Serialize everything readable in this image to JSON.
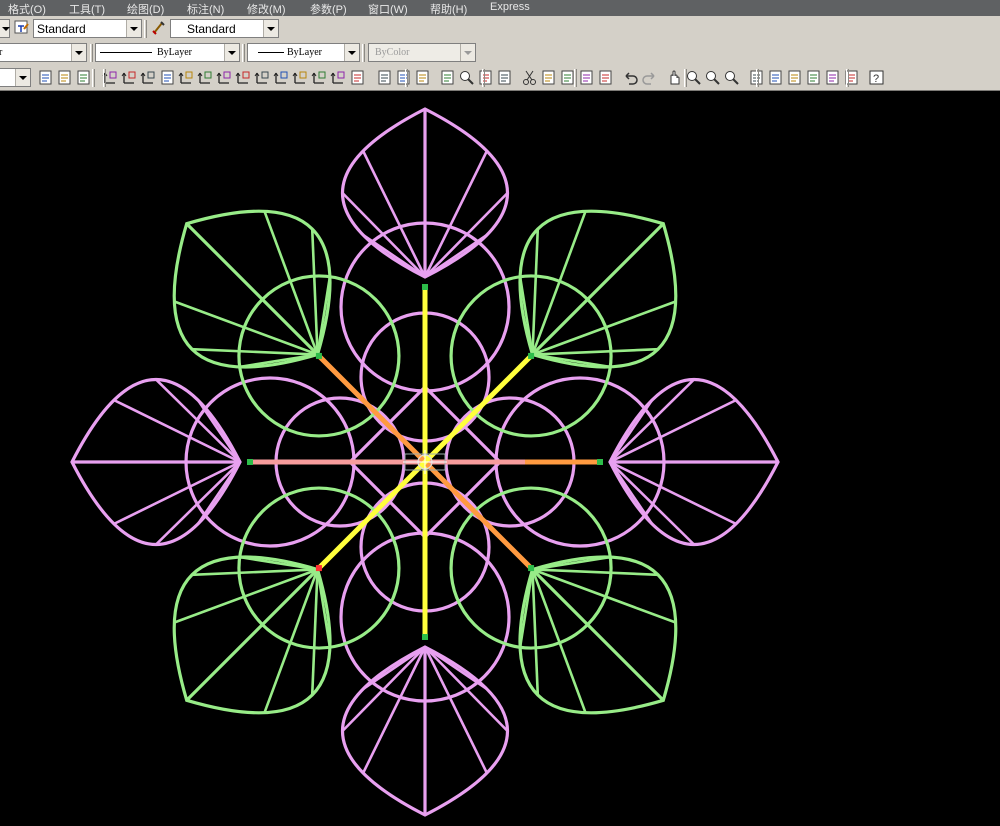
{
  "menubar": {
    "items": [
      {
        "label": "格式(O)"
      },
      {
        "label": "工具(T)"
      },
      {
        "label": "绘图(D)"
      },
      {
        "label": "标注(N)"
      },
      {
        "label": "修改(M)"
      },
      {
        "label": "参数(P)"
      },
      {
        "label": "窗口(W)"
      },
      {
        "label": "帮助(H)"
      },
      {
        "label": "Express"
      }
    ]
  },
  "styles_toolbar": {
    "text_style": "Standard",
    "dim_style": "Standard"
  },
  "properties_toolbar": {
    "layer_fragment": "r",
    "linetype": "ByLayer",
    "lineweight": "ByLayer",
    "plot_style": "ByColor"
  },
  "icons": {
    "toolbar_row3": [
      "layer-previous-icon",
      "layer-states-icon",
      "layer-tool-icon",
      "ucs-icon",
      "ucs-world-icon",
      "ucs-previous-icon",
      "named-ucs-icon",
      "ucs-origin-icon",
      "ucs-zaxis-icon",
      "ucs-3point-icon",
      "ucs-object-icon",
      "ucs-face-icon",
      "ucs-view-icon",
      "ucs-x-icon",
      "ucs-y-icon",
      "ucs-z-icon",
      "apply-ucs-icon",
      "qnew-icon",
      "open-icon",
      "save-icon",
      "plot-icon",
      "plot-preview-icon",
      "publish-icon",
      "3d-dwf-icon",
      "cut-icon",
      "copy-icon",
      "paste-icon",
      "match-properties-icon",
      "block-editor-icon",
      "undo-icon",
      "redo-icon",
      "pan-icon",
      "zoom-realtime-icon",
      "zoom-window-icon",
      "zoom-previous-icon",
      "properties-icon",
      "design-center-icon",
      "tool-palettes-icon",
      "sheet-set-icon",
      "markup-icon",
      "quickcalc-icon",
      "help-icon"
    ]
  },
  "colors": {
    "canvas_background": "#000000",
    "violet_lines": "#e8a0f0",
    "green_lines": "#98ec88",
    "yellow_highlight": "#ffff3c",
    "orange_highlight": "#ff9a40",
    "pink_axis": "#f79c9c",
    "toolbar_bg": "#d4d0c8",
    "menubar_bg": "#5f6163"
  }
}
